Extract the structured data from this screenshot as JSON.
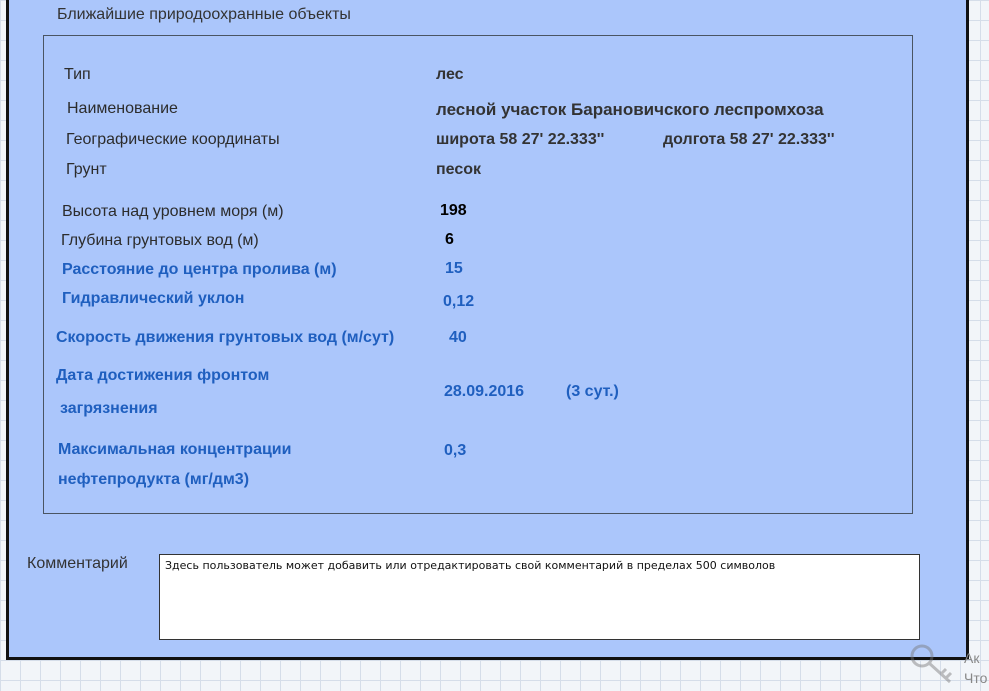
{
  "panel": {
    "title": "Ближайшие природоохранные объекты"
  },
  "fields": {
    "type_label": "Тип",
    "type_value": "лес",
    "name_label": "Наименование",
    "name_value": "лесной участок Барановичского леспромхоза",
    "coords_label": "Географические координаты",
    "lat_value": "широта 58 27' 22.333''",
    "lon_value": "долгота 58 27' 22.333''",
    "soil_label": "Грунт",
    "soil_value": "песок",
    "altitude_label": "Высота над уровнем моря (м)",
    "altitude_value": "198",
    "groundwater_depth_label": "Глубина грунтовых вод (м)",
    "groundwater_depth_value": "6",
    "distance_label": "Расстояние до центра пролива (м)",
    "distance_value": "15",
    "gradient_label": "Гидравлический уклон",
    "gradient_value": "0,12",
    "velocity_label": "Скорость движения грунтовых вод (м/сут)",
    "velocity_value": "40",
    "date_label_line1": "Дата  достижения фронтом",
    "date_label_line2": "загрязнения",
    "date_value": "28.09.2016",
    "date_days": "(3 сут.)",
    "max_conc_label_line1": "Максимальная концентрации",
    "max_conc_label_line2": "нефтепродукта  (мг/дм3)",
    "max_conc_value": "0,3"
  },
  "comment": {
    "label": "Комментарий",
    "text": "Здесь пользователь может добавить или отредактировать свой комментарий в пределах 500 символов"
  },
  "watermark": {
    "line1": "Ак",
    "line2": "Что"
  }
}
